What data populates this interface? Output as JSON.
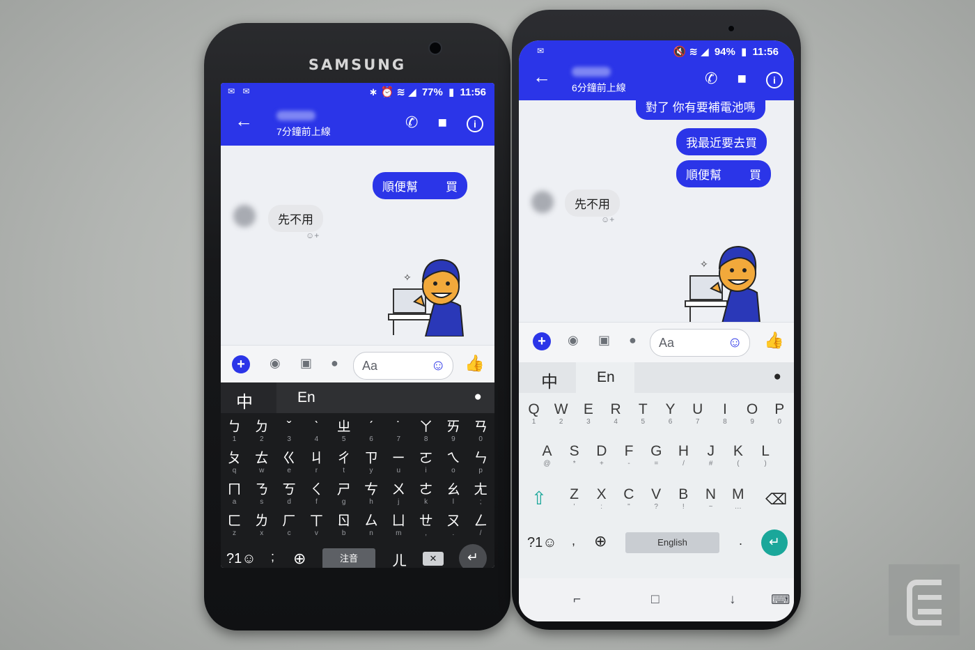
{
  "s7": {
    "brand": "SAMSUNG",
    "status": {
      "left_icons": "✉ ✉",
      "icons": "∗ ⏰ ≋ ◢",
      "battery": "77%",
      "time": "11:56"
    },
    "appbar": {
      "back": "←",
      "subtitle": "7分鐘前上線",
      "call": "✆",
      "video": "■",
      "info": "i"
    },
    "messages": {
      "out_top": "",
      "out_1a": "順便幫",
      "out_1b": "買",
      "in_1": "先不用",
      "react": "☺+"
    },
    "composer": {
      "plus": "+",
      "camera": "◉",
      "image": "▣",
      "mic": "●",
      "placeholder": "Aa",
      "emoji": "☺",
      "like": "👍"
    },
    "keyboard": {
      "lang_zh": "中",
      "lang_en": "En",
      "mic": "●",
      "row1": [
        [
          "ㄅ",
          "1"
        ],
        [
          "ㄉ",
          "2"
        ],
        [
          "ˇ",
          "3"
        ],
        [
          "ˋ",
          "4"
        ],
        [
          "ㄓ",
          "5"
        ],
        [
          "ˊ",
          "6"
        ],
        [
          "˙",
          "7"
        ],
        [
          "ㄚ",
          "8"
        ],
        [
          "ㄞ",
          "9"
        ],
        [
          "ㄢ",
          "0"
        ]
      ],
      "row2": [
        [
          "ㄆ",
          "q"
        ],
        [
          "ㄊ",
          "w"
        ],
        [
          "ㄍ",
          "e"
        ],
        [
          "ㄐ",
          "r"
        ],
        [
          "ㄔ",
          "t"
        ],
        [
          "ㄗ",
          "y"
        ],
        [
          "ㄧ",
          "u"
        ],
        [
          "ㄛ",
          "i"
        ],
        [
          "ㄟ",
          "o"
        ],
        [
          "ㄣ",
          "p"
        ]
      ],
      "row3": [
        [
          "ㄇ",
          "a"
        ],
        [
          "ㄋ",
          "s"
        ],
        [
          "ㄎ",
          "d"
        ],
        [
          "ㄑ",
          "f"
        ],
        [
          "ㄕ",
          "g"
        ],
        [
          "ㄘ",
          "h"
        ],
        [
          "ㄨ",
          "j"
        ],
        [
          "ㄜ",
          "k"
        ],
        [
          "ㄠ",
          "l"
        ],
        [
          "ㄤ",
          ";"
        ]
      ],
      "row4": [
        [
          "ㄈ",
          "z"
        ],
        [
          "ㄌ",
          "x"
        ],
        [
          "ㄏ",
          "c"
        ],
        [
          "ㄒ",
          "v"
        ],
        [
          "ㄖ",
          "b"
        ],
        [
          "ㄙ",
          "n"
        ],
        [
          "ㄩ",
          "m"
        ],
        [
          "ㄝ",
          ","
        ],
        [
          "ㄡ",
          "."
        ],
        [
          "ㄥ",
          "/"
        ]
      ],
      "sym": "?1☺",
      "punct": ";",
      "globe": "⊕",
      "space": "注音",
      "er": "ㄦ",
      "delete": "✕",
      "enter": "↵"
    }
  },
  "s8": {
    "status": {
      "left_icons": "✉",
      "icons": "🔇 ≋ ◢",
      "battery": "94%",
      "time": "11:56"
    },
    "appbar": {
      "back": "←",
      "subtitle": "6分鐘前上線",
      "call": "✆",
      "video": "■",
      "info": "i"
    },
    "messages": {
      "out_top": "對了 你有要補電池嗎",
      "out_2": "我最近要去買",
      "out_3a": "順便幫",
      "out_3b": "買",
      "in_1": "先不用",
      "react": "☺+"
    },
    "composer": {
      "plus": "+",
      "camera": "◉",
      "image": "▣",
      "mic": "●",
      "placeholder": "Aa",
      "emoji": "☺",
      "like": "👍"
    },
    "keyboard": {
      "lang_zh": "中",
      "lang_en": "En",
      "mic": "●",
      "row1": [
        [
          "Q",
          "1"
        ],
        [
          "W",
          "2"
        ],
        [
          "E",
          "3"
        ],
        [
          "R",
          "4"
        ],
        [
          "T",
          "5"
        ],
        [
          "Y",
          "6"
        ],
        [
          "U",
          "7"
        ],
        [
          "I",
          "8"
        ],
        [
          "O",
          "9"
        ],
        [
          "P",
          "0"
        ]
      ],
      "row2": [
        [
          "A",
          "@"
        ],
        [
          "S",
          "*"
        ],
        [
          "D",
          "+"
        ],
        [
          "F",
          "-"
        ],
        [
          "G",
          "="
        ],
        [
          "H",
          "/"
        ],
        [
          "J",
          "#"
        ],
        [
          "K",
          "("
        ],
        [
          "L",
          ")"
        ]
      ],
      "row3": [
        [
          "Z",
          "'"
        ],
        [
          "X",
          ":"
        ],
        [
          "C",
          "\""
        ],
        [
          "V",
          "?"
        ],
        [
          "B",
          "!"
        ],
        [
          "N",
          "~"
        ],
        [
          "M",
          "…"
        ]
      ],
      "shift": "⇧",
      "delete": "⌫",
      "sym": "?1☺",
      "comma": ",",
      "globe": "⊕",
      "space": "English",
      "period": ".",
      "enter": "↵"
    },
    "navbar": {
      "recent": "⌐",
      "home": "□",
      "back": "↓",
      "keyboard": "⌨"
    }
  },
  "colors": {
    "messenger_blue": "#2b35e8",
    "enter_teal": "#1aa79a"
  }
}
